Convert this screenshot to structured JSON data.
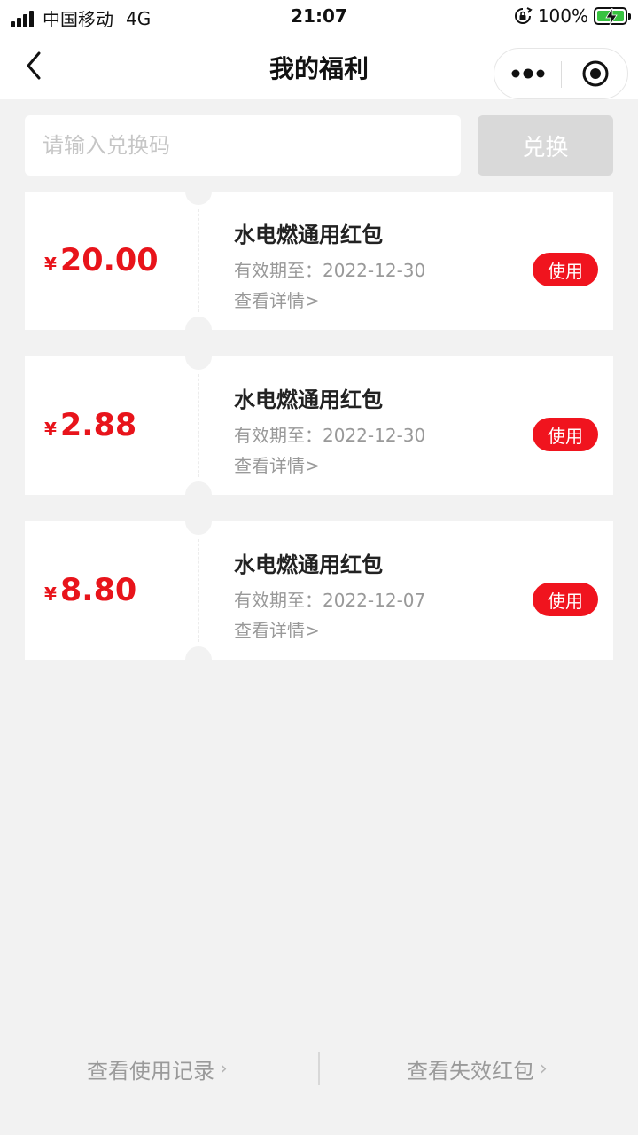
{
  "status_bar": {
    "carrier": "中国移动",
    "network": "4G",
    "time": "21:07",
    "battery": "100%"
  },
  "nav": {
    "title": "我的福利"
  },
  "redeem": {
    "placeholder": "请输入兑换码",
    "button_label": "兑换"
  },
  "coupons": [
    {
      "currency": "¥",
      "amount": "20.00",
      "title": "水电燃通用红包",
      "expiry": "有效期至：2022-12-30",
      "detail": "查看详情>",
      "action": "使用"
    },
    {
      "currency": "¥",
      "amount": "2.88",
      "title": "水电燃通用红包",
      "expiry": "有效期至：2022-12-30",
      "detail": "查看详情>",
      "action": "使用"
    },
    {
      "currency": "¥",
      "amount": "8.80",
      "title": "水电燃通用红包",
      "expiry": "有效期至：2022-12-07",
      "detail": "查看详情>",
      "action": "使用"
    }
  ],
  "footer": {
    "history_label": "查看使用记录",
    "expired_label": "查看失效红包",
    "chevron": "›"
  },
  "colors": {
    "accent_red": "#f0141e",
    "amount_red": "#e8141b",
    "background": "#f2f2f2",
    "battery_green": "#38c240"
  },
  "icons": [
    "signal-icon",
    "screen-rotation-lock-icon",
    "battery-icon",
    "back-icon",
    "more-icon",
    "close-mini-program-icon",
    "chevron-right-icon"
  ]
}
